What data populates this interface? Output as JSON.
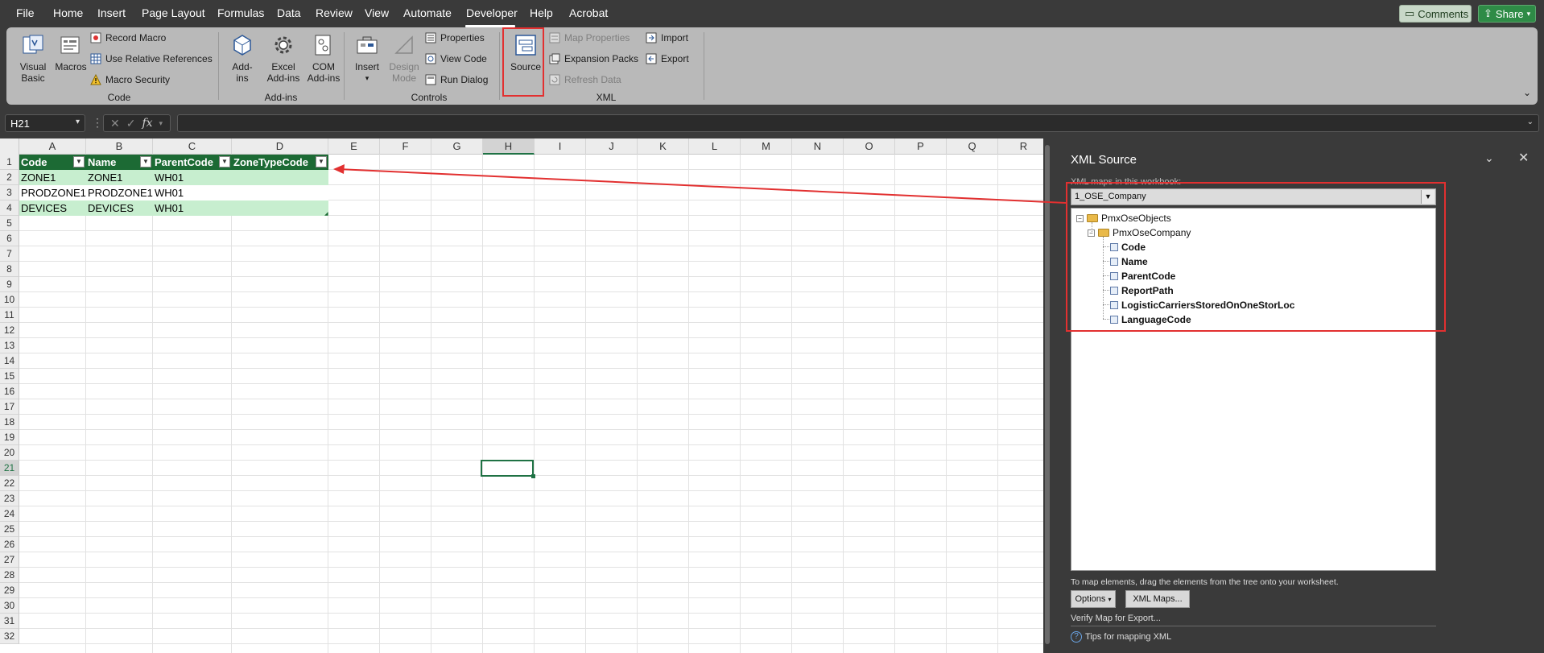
{
  "menu": {
    "tabs": [
      "File",
      "Home",
      "Insert",
      "Page Layout",
      "Formulas",
      "Data",
      "Review",
      "View",
      "Automate",
      "Developer",
      "Help",
      "Acrobat"
    ],
    "active": "Developer",
    "comments_label": "Comments",
    "share_label": "Share"
  },
  "ribbon": {
    "code": {
      "label": "Code",
      "visual_basic": "Visual\nBasic",
      "macros": "Macros",
      "record_macro": "Record Macro",
      "relative_refs": "Use Relative References",
      "macro_security": "Macro Security"
    },
    "addins": {
      "label": "Add-ins",
      "addins": "Add-\nins",
      "excel_addins": "Excel\nAdd-ins",
      "com_addins": "COM\nAdd-ins"
    },
    "controls": {
      "label": "Controls",
      "insert": "Insert",
      "design_mode": "Design\nMode",
      "properties": "Properties",
      "view_code": "View Code",
      "run_dialog": "Run Dialog"
    },
    "xml": {
      "label": "XML",
      "source": "Source",
      "map_properties": "Map Properties",
      "expansion_packs": "Expansion Packs",
      "refresh_data": "Refresh Data",
      "import": "Import",
      "export": "Export"
    }
  },
  "formula_bar": {
    "name_box": "H21",
    "fx_label": "fx",
    "value": ""
  },
  "sheet": {
    "columns": [
      "A",
      "B",
      "C",
      "D",
      "E",
      "F",
      "G",
      "H",
      "I",
      "J",
      "K",
      "L",
      "M",
      "N",
      "O",
      "P",
      "Q",
      "R"
    ],
    "rows": [
      "1",
      "2",
      "3",
      "4",
      "5",
      "6",
      "7",
      "8",
      "9",
      "10",
      "11",
      "12",
      "13",
      "14",
      "15",
      "16",
      "17",
      "18",
      "19",
      "20",
      "21",
      "22",
      "23",
      "24",
      "25",
      "26",
      "27",
      "28",
      "29",
      "30",
      "31",
      "32"
    ],
    "selected_column": "H",
    "selected_row": "21",
    "table_headers": [
      "Code",
      "Name",
      "ParentCode",
      "ZoneTypeCode"
    ],
    "table_rows": [
      [
        "ZONE1",
        "ZONE1",
        "WH01",
        ""
      ],
      [
        "PRODZONE1",
        "PRODZONE1",
        "WH01",
        ""
      ],
      [
        "DEVICES",
        "DEVICES",
        "WH01",
        ""
      ]
    ]
  },
  "xml_source": {
    "title": "XML Source",
    "maps_label": "XML maps in this workbook:",
    "selected_map": "1_OSE_Company",
    "tree": {
      "root": "PmxOseObjects",
      "child": "PmxOseCompany",
      "elements": [
        "Code",
        "Name",
        "ParentCode",
        "ReportPath",
        "LogisticCarriersStoredOnOneStorLoc",
        "LanguageCode"
      ]
    },
    "hint": "To map elements, drag the elements from the tree onto your worksheet.",
    "options_label": "Options",
    "xml_maps_label": "XML Maps...",
    "verify_label": "Verify Map for Export...",
    "tips_label": "Tips for mapping XML"
  },
  "colors": {
    "table_header": "#1c6a34",
    "table_band": "#c7eecf",
    "annotation": "#e23030",
    "selection": "#1f7244"
  }
}
